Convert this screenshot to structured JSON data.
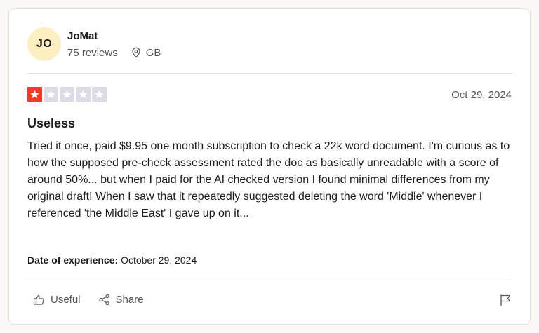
{
  "reviewer": {
    "initials": "JO",
    "name": "JoMat",
    "review_count": "75 reviews",
    "country": "GB",
    "avatar_color": "#fcefc2"
  },
  "review": {
    "rating": 1,
    "max_rating": 5,
    "star_color_active": "#ff3722",
    "star_color_inactive": "#dcdce6",
    "date": "Oct 29, 2024",
    "title": "Useless",
    "body": "Tried it once, paid $9.95 one month subscription to check a 22k word document. I'm curious as to how the supposed pre-check assessment rated the doc as basically unreadable with a score of around 50%... but when I paid for the AI checked version I found minimal differences from my original draft! When I saw that it repeatedly suggested deleting the word 'Middle' whenever I referenced 'the Middle East' I gave up on it...",
    "experience_label": "Date of experience:",
    "experience_date": "October 29, 2024"
  },
  "actions": {
    "useful_label": "Useful",
    "share_label": "Share",
    "useful_icon": "thumbs-up-icon",
    "share_icon": "share-icon",
    "flag_icon": "flag-icon"
  }
}
